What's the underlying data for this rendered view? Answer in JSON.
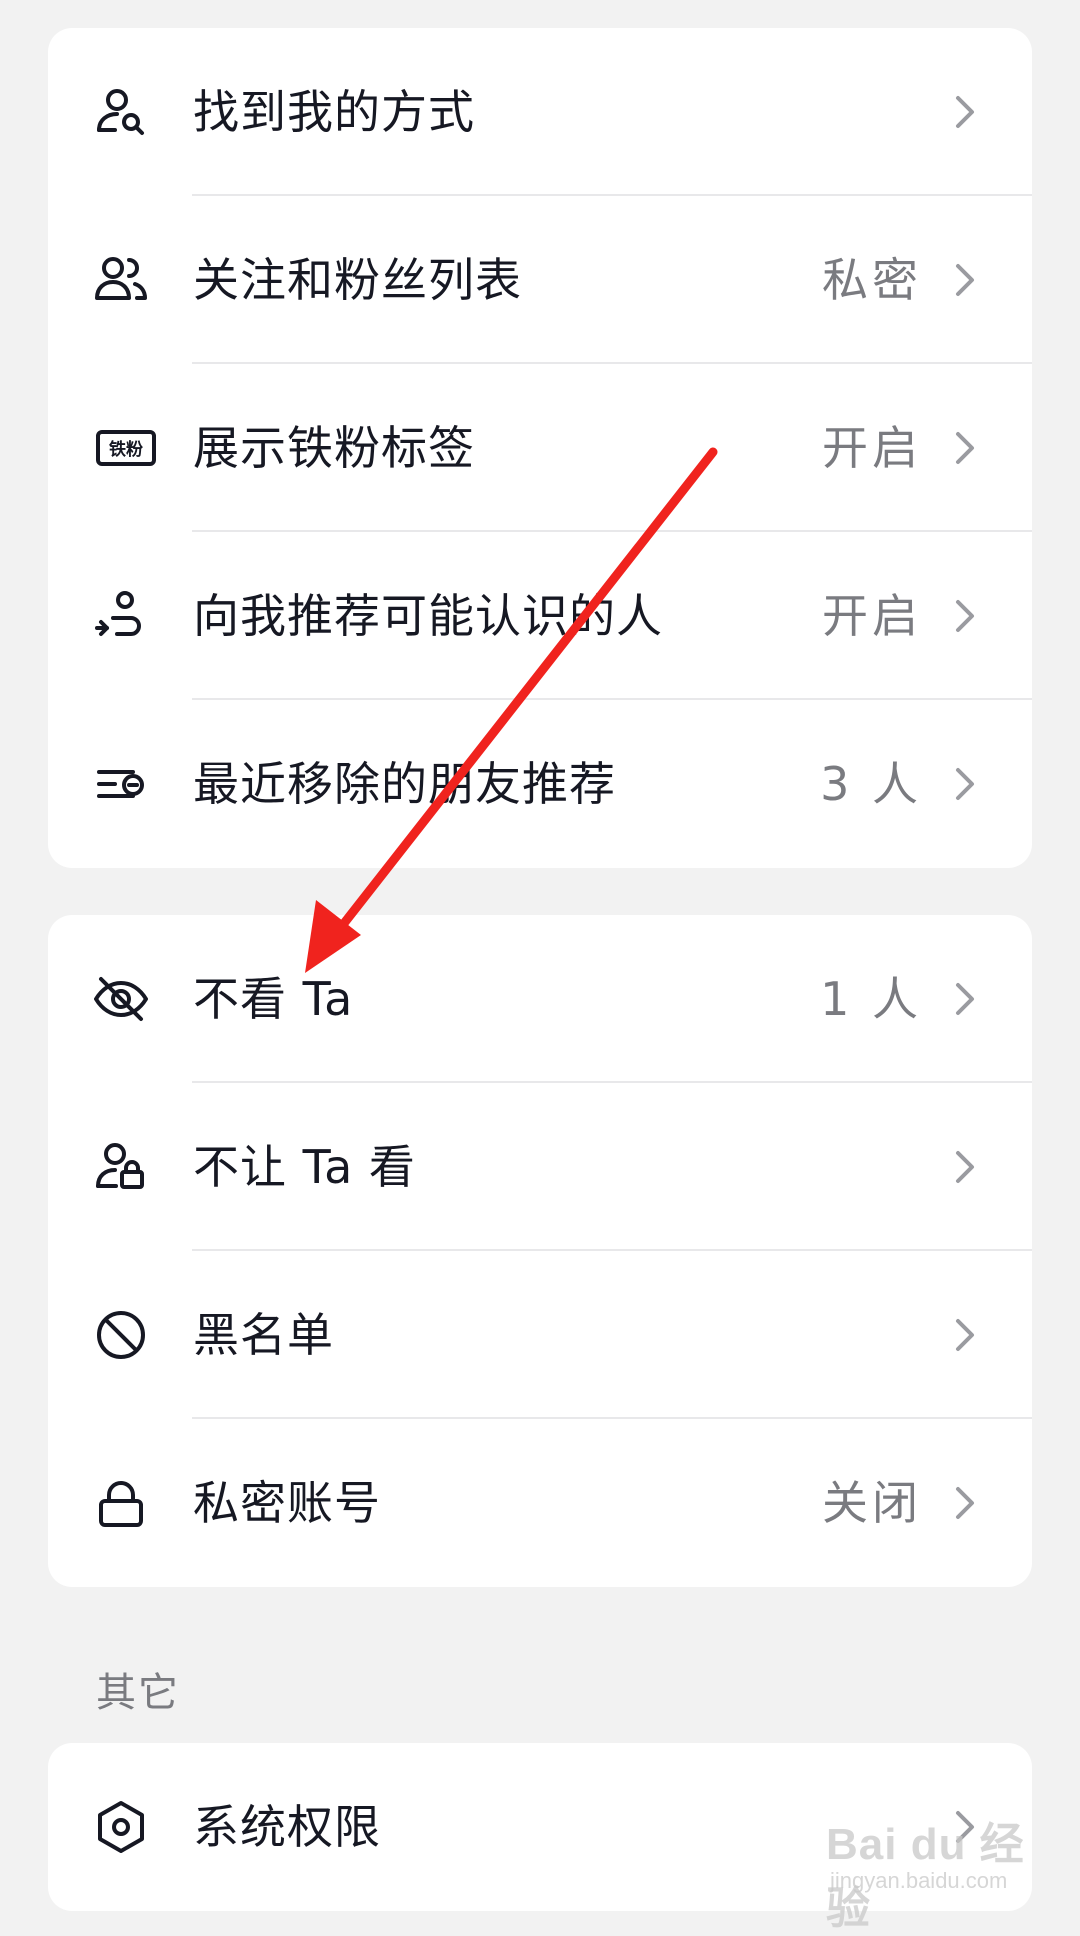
{
  "group1": {
    "items": [
      {
        "label": "找到我的方式",
        "value": "",
        "icon": "person-search-icon"
      },
      {
        "label": "关注和粉丝列表",
        "value": "私密",
        "icon": "people-icon"
      },
      {
        "label": "展示铁粉标签",
        "value": "开启",
        "icon": "fan-badge-icon",
        "badge_text": "铁粉"
      },
      {
        "label": "向我推荐可能认识的人",
        "value": "开启",
        "icon": "recommend-path-icon"
      },
      {
        "label": "最近移除的朋友推荐",
        "value": "3 人",
        "icon": "removed-list-icon"
      }
    ]
  },
  "group2": {
    "items": [
      {
        "label": "不看 Ta",
        "value": "1 人",
        "icon": "eye-off-icon"
      },
      {
        "label": "不让 Ta 看",
        "value": "",
        "icon": "person-lock-icon"
      },
      {
        "label": "黑名单",
        "value": "",
        "icon": "block-icon"
      },
      {
        "label": "私密账号",
        "value": "关闭",
        "icon": "lock-icon"
      }
    ]
  },
  "other_section": {
    "title": "其它",
    "items": [
      {
        "label": "系统权限",
        "value": "",
        "icon": "hexagon-settings-icon"
      }
    ]
  },
  "annotation": {
    "color": "#f0231e"
  },
  "watermark": {
    "main": "Bai du 经验",
    "sub": "jingyan.baidu.com"
  }
}
